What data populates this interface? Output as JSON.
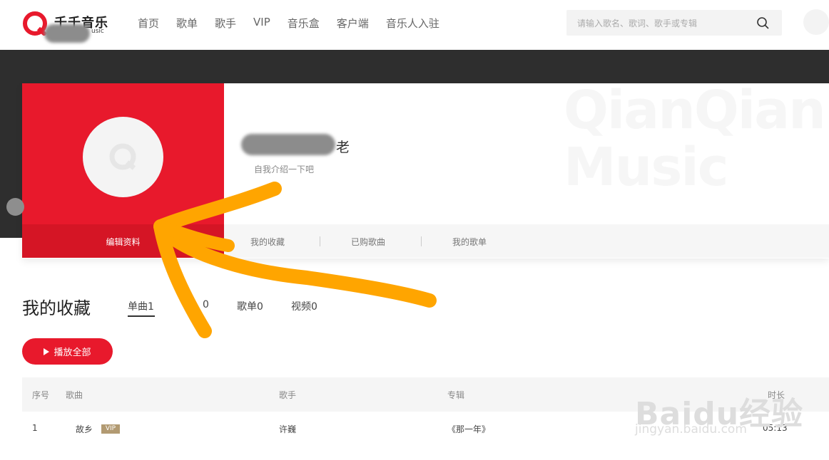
{
  "header": {
    "logo_text": "千千音乐",
    "logo_sub": "usic",
    "nav": [
      "首页",
      "歌单",
      "歌手",
      "VIP",
      "音乐盒",
      "客户端",
      "音乐人入驻"
    ],
    "search_placeholder": "请输入歌名、歌词、歌手或专辑"
  },
  "profile": {
    "username_suffix": "老",
    "bio": "自我介绍一下吧",
    "edit_label": "编辑资料",
    "tabs": [
      "我的收藏",
      "已购歌曲",
      "我的歌单"
    ],
    "watermark": [
      "QianQian",
      "Music"
    ]
  },
  "favorites": {
    "title": "我的收藏",
    "subtabs": [
      "单曲1",
      "0",
      "歌单0",
      "视频0"
    ],
    "play_all": "播放全部",
    "columns": [
      "序号",
      "歌曲",
      "歌手",
      "专辑",
      "时长"
    ],
    "rows": [
      {
        "index": "1",
        "song": "故乡",
        "badge": "VIP",
        "artist": "许巍",
        "album": "《那一年》",
        "duration": "05:13"
      }
    ]
  },
  "watermark_site": {
    "brand": "Baidu经验",
    "domain": "jingyan.baidu.com"
  },
  "colors": {
    "brand_red": "#e8192c",
    "arrow": "#ffa500",
    "banner": "#2e2e2e"
  }
}
